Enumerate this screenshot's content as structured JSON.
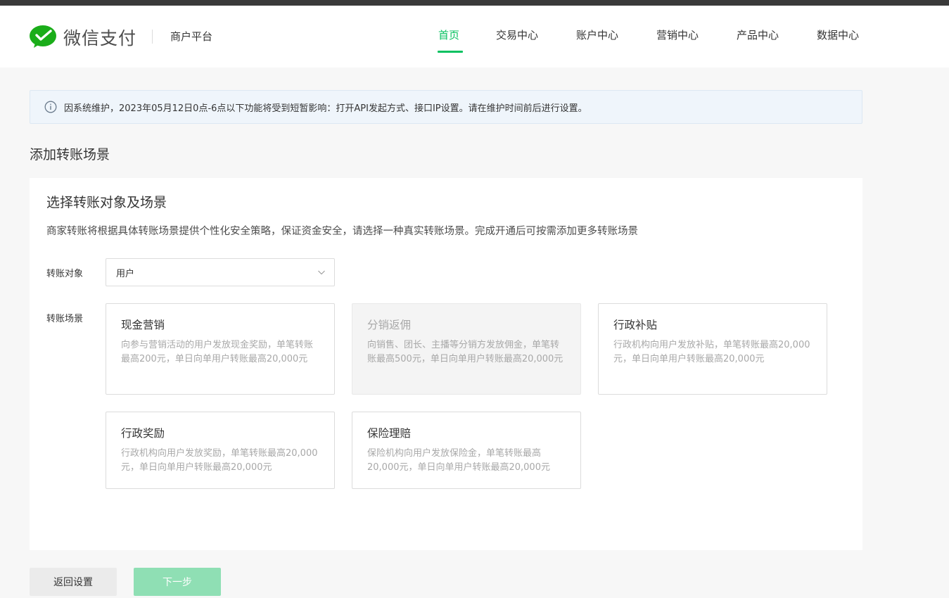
{
  "header": {
    "brand": "微信支付",
    "platform": "商户平台",
    "nav": [
      "首页",
      "交易中心",
      "账户中心",
      "营销中心",
      "产品中心",
      "数据中心"
    ],
    "active_nav": "首页",
    "accent_color": "#07c160"
  },
  "notice": {
    "text": "因系统维护，2023年05月12日0点-6点以下功能将受到短暂影响：打开API发起方式、接口IP设置。请在维护时间前后进行设置。"
  },
  "page": {
    "title": "添加转账场景"
  },
  "section": {
    "title": "选择转账对象及场景",
    "desc": "商家转账将根据具体转账场景提供个性化安全策略，保证资金安全，请选择一种真实转账场景。完成开通后可按需添加更多转账场景"
  },
  "form": {
    "target_label": "转账对象",
    "target_value": "用户",
    "scene_label": "转账场景"
  },
  "cards": [
    {
      "title": "现金营销",
      "desc": "向参与营销活动的用户发放现金奖励，单笔转账最高200元，单日向单用户转账最高20,000元",
      "disabled": false
    },
    {
      "title": "分销返佣",
      "desc": "向销售、团长、主播等分销方发放佣金，单笔转账最高500元，单日向单用户转账最高20,000元",
      "disabled": true
    },
    {
      "title": "行政补贴",
      "desc": "行政机构向用户发放补贴，单笔转账最高20,000元，单日向单用户转账最高20,000元",
      "disabled": false
    },
    {
      "title": "行政奖励",
      "desc": "行政机构向用户发放奖励，单笔转账最高20,000元，单日向单用户转账最高20,000元",
      "disabled": false
    },
    {
      "title": "保险理赔",
      "desc": "保险机构向用户发放保险金，单笔转账最高20,000元，单日向单用户转账最高20,000元",
      "disabled": false
    }
  ],
  "buttons": {
    "back": "返回设置",
    "next": "下一步"
  }
}
